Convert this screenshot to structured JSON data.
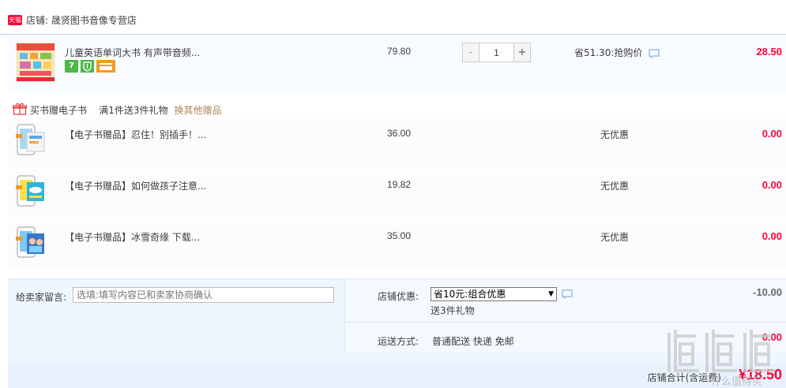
{
  "shop": {
    "badge": "天猫",
    "name": "店铺: 晟贤图书音像专营店"
  },
  "main_item": {
    "title": "儿童英语单词大书 有声带音频...",
    "price": "79.80",
    "quantity": "1",
    "minus": "-",
    "plus": "+",
    "promo": "省51.30:抢购价",
    "subtotal": "28.50",
    "tags": [
      "7",
      "",
      ""
    ]
  },
  "gift_bar": {
    "text": "买书赠电子书    满1件送3件礼物",
    "link": "换其他赠品"
  },
  "gift_items": [
    {
      "title": "【电子书赠品】忍住！别插手！...",
      "price": "36.00",
      "promo": "无优惠",
      "subtotal": "0.00"
    },
    {
      "title": "【电子书赠品】如何做孩子注意...",
      "price": "19.82",
      "promo": "无优惠",
      "subtotal": "0.00"
    },
    {
      "title": "【电子书赠品】冰雪奇缘 下载...",
      "price": "35.00",
      "promo": "无优惠",
      "subtotal": "0.00"
    }
  ],
  "message": {
    "label": "给卖家留言:",
    "placeholder": "选填:填写内容已和卖家协商确认"
  },
  "discount": {
    "label": "店铺优惠:",
    "selected": "省10元:组合优惠",
    "sub": "送3件礼物",
    "value": "-10.00"
  },
  "shipping": {
    "label": "运送方式:",
    "value": "普通配送 快递 免邮",
    "price": "0.00"
  },
  "total": {
    "label": "店铺合计(含运费)",
    "value": "¥18.50"
  },
  "watermark": {
    "text": "什么值得买"
  },
  "colors": {
    "accent": "#ff0036",
    "link": "#b0875a",
    "border": "#b2d1ff"
  }
}
